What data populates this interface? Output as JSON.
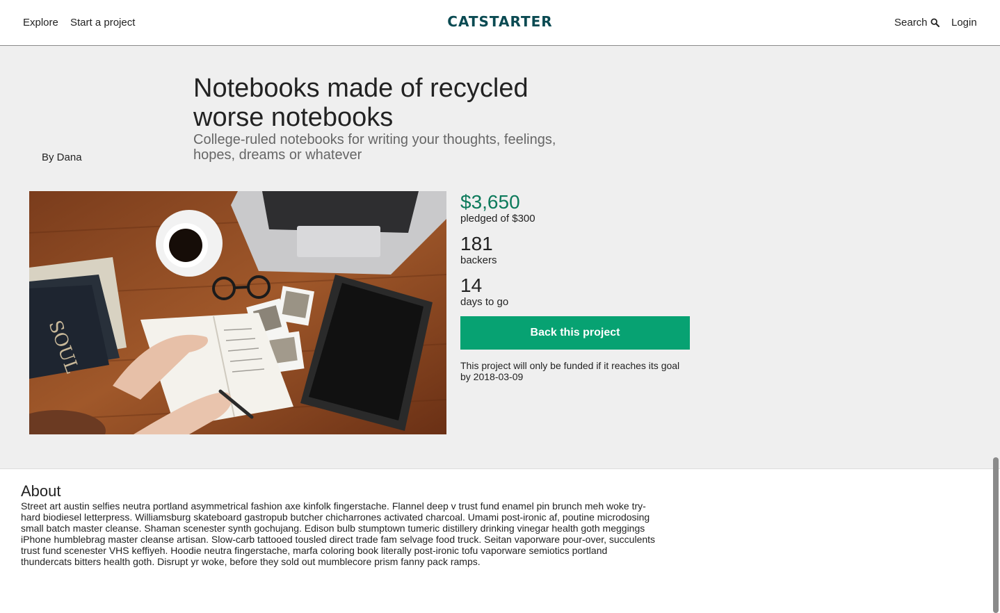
{
  "header": {
    "nav": {
      "explore": "Explore",
      "start_project": "Start a project"
    },
    "logo": "CATSTARTER",
    "search_label": "Search",
    "login_label": "Login"
  },
  "project": {
    "by": "By Dana",
    "title": "Notebooks made of recycled worse notebooks",
    "subtitle": "College-ruled notebooks for writing your thoughts, feelings, hopes, dreams or whatever",
    "image_icon": "project-photo-notebooks-laptop-coffee"
  },
  "stats": {
    "pledged_amount": "$3,650",
    "pledged_label": "pledged of $300",
    "backers_count": "181",
    "backers_label": "backers",
    "days_count": "14",
    "days_label": "days to go"
  },
  "cta": {
    "back_label": "Back this project",
    "funding_note": "This project will only be funded if it reaches its goal by 2018-03-09"
  },
  "about": {
    "heading": "About",
    "body": "Street art austin selfies neutra portland asymmetrical fashion axe kinfolk fingerstache. Flannel deep v trust fund enamel pin brunch meh woke try-hard biodiesel letterpress. Williamsburg skateboard gastropub butcher chicharrones activated charcoal. Umami post-ironic af, poutine microdosing small batch master cleanse. Shaman scenester synth gochujang. Edison bulb stumptown tumeric distillery drinking vinegar health goth meggings iPhone humblebrag master cleanse artisan. Slow-carb tattooed tousled direct trade fam selvage food truck. Seitan vaporware pour-over, succulents trust fund scenester VHS keffiyeh. Hoodie neutra fingerstache, marfa coloring book literally post-ironic tofu vaporware semiotics portland thundercats bitters health goth. Disrupt yr woke, before they sold out mumblecore prism fanny pack ramps."
  },
  "colors": {
    "brand": "#0a4a52",
    "accent_green": "#07a272",
    "money_green": "#0d7a5b",
    "hero_bg": "#efefef"
  }
}
